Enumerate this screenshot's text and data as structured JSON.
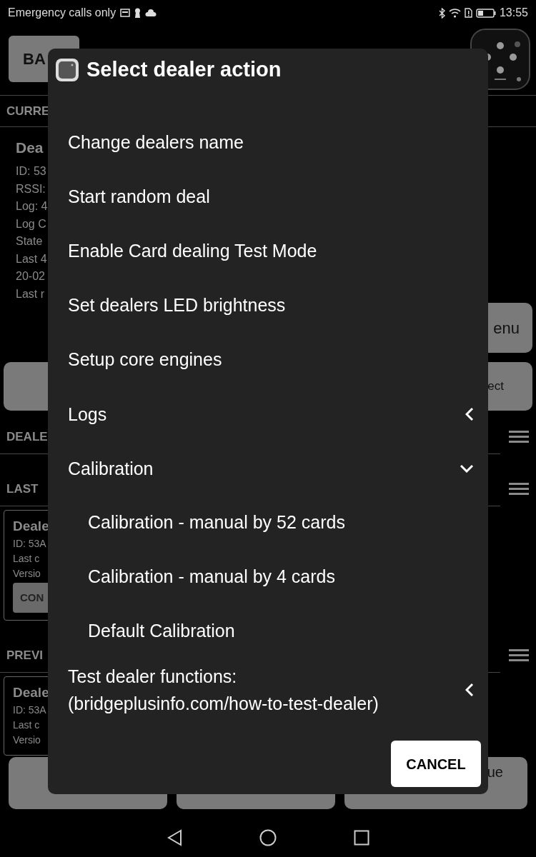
{
  "status_bar": {
    "carrier": "Emergency calls only",
    "time": "13:55"
  },
  "background": {
    "back_button": "BA",
    "current_header": "CURRE",
    "dealer": {
      "name": "Dea",
      "lines": [
        "ID: 53",
        "RSSI:",
        "Log: 4",
        "Log C",
        "State",
        "Last 4",
        "20-02",
        "Last r"
      ]
    },
    "menu_button": "enu",
    "connect_button": "ect",
    "sections": [
      {
        "header": "DEALE"
      },
      {
        "header": "LAST",
        "card": {
          "name": "Deale",
          "lines": [
            "ID: 53A",
            "Last c",
            "Versio"
          ],
          "button": "CON"
        }
      },
      {
        "header": "PREVI",
        "card": {
          "name": "Deale",
          "lines": [
            "ID: 53A",
            "Last c",
            "Versio"
          ]
        }
      }
    ],
    "guide_button": [
      "ue"
    ]
  },
  "dialog": {
    "title": "Select dealer action",
    "items": [
      {
        "kind": "action",
        "label": "Change dealers name"
      },
      {
        "kind": "action",
        "label": "Start random deal"
      },
      {
        "kind": "action",
        "label": "Enable Card dealing Test Mode"
      },
      {
        "kind": "action",
        "label": "Set dealers LED brightness"
      },
      {
        "kind": "action",
        "label": "Setup core engines"
      },
      {
        "kind": "group",
        "label": "Logs",
        "expanded": false
      },
      {
        "kind": "group",
        "label": "Calibration",
        "expanded": true,
        "children": [
          {
            "label": "Calibration - manual by 52 cards"
          },
          {
            "label": "Calibration - manual by 4 cards"
          },
          {
            "label": "Default Calibration"
          }
        ]
      },
      {
        "kind": "group",
        "label": "Test dealer functions: (bridgeplusinfo.com/how-to-test-dealer)",
        "expanded": false
      }
    ],
    "cancel": "CANCEL"
  }
}
